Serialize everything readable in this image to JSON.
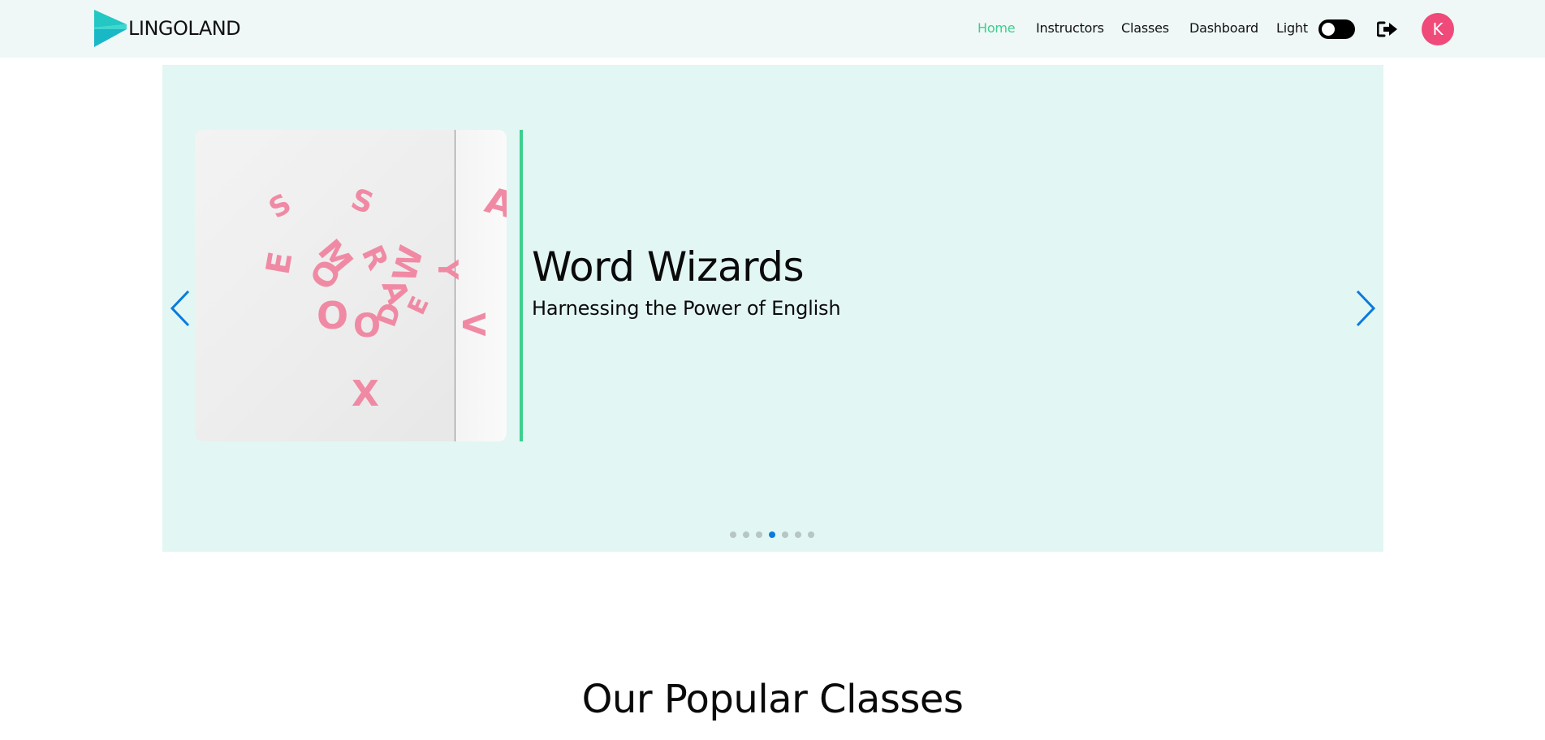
{
  "brand": {
    "name": "LINGOLAND"
  },
  "nav": {
    "links": [
      {
        "label": "Home",
        "active": true
      },
      {
        "label": "Instructors",
        "active": false
      },
      {
        "label": "Classes",
        "active": false
      },
      {
        "label": "Dashboard",
        "active": false
      }
    ],
    "theme_label": "Light",
    "theme_toggle_on": false,
    "logout_icon": "logout-icon",
    "avatar_initial": "K"
  },
  "hero": {
    "title": "Word Wizards",
    "subtitle": "Harnessing the Power of English",
    "slide_count": 7,
    "active_slide": 4,
    "image_icon": "pink-letters-photo"
  },
  "popular": {
    "title": "Our Popular Classes"
  },
  "colors": {
    "accent": "#3ccf8e",
    "nav_bg": "#eff8f7",
    "hero_bg": "#e2f6f4",
    "arrow": "#0a7bdc",
    "avatar": "#ef4a7a"
  }
}
